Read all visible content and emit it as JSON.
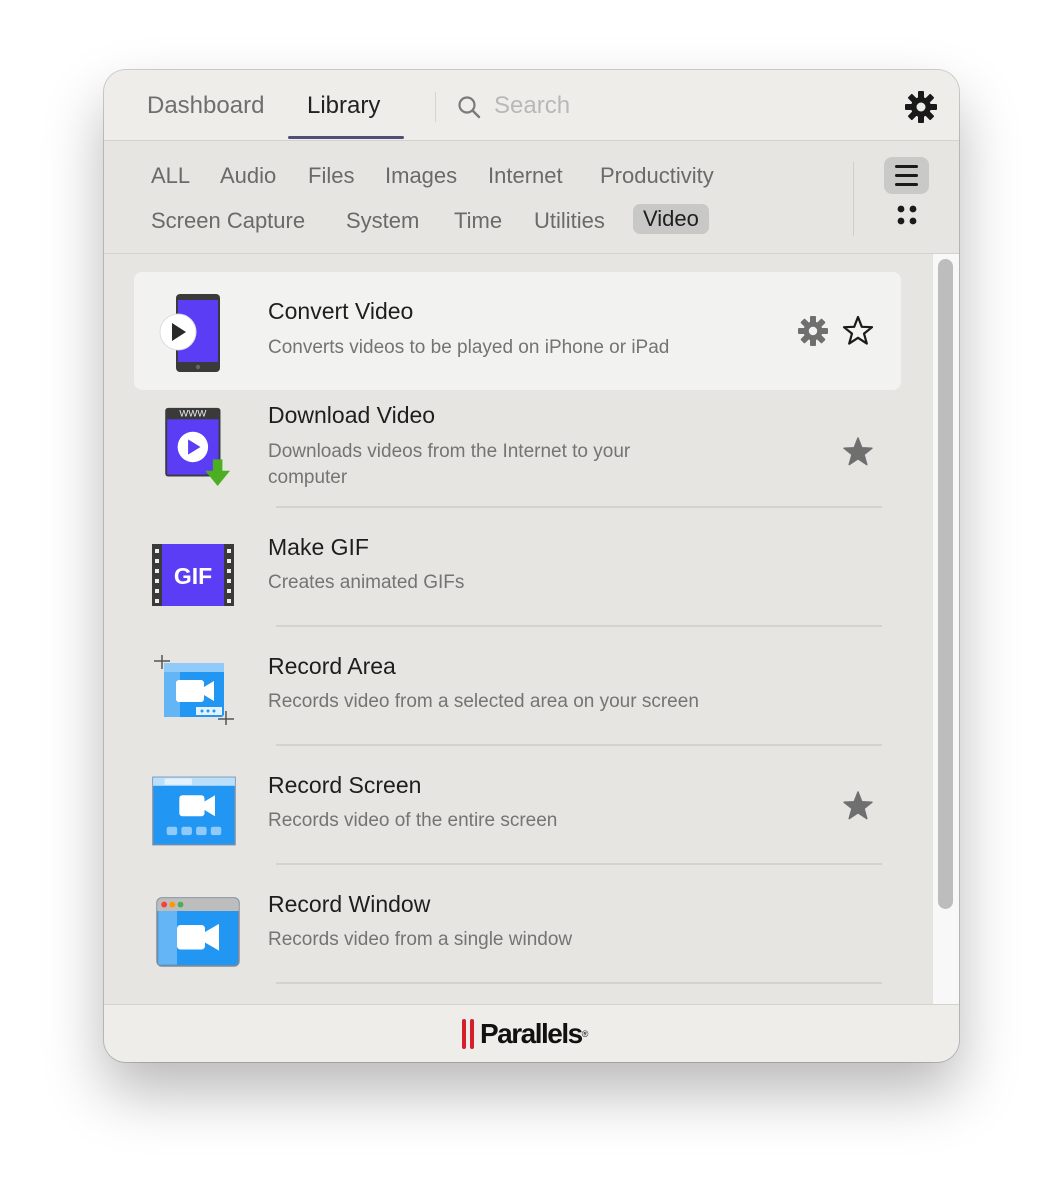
{
  "header": {
    "tabs": [
      {
        "label": "Dashboard",
        "active": false
      },
      {
        "label": "Library",
        "active": true
      }
    ],
    "search": {
      "placeholder": "Search",
      "value": ""
    },
    "settings_icon": "gear-icon"
  },
  "categories": {
    "items": [
      {
        "label": "ALL",
        "active": false
      },
      {
        "label": "Audio",
        "active": false
      },
      {
        "label": "Files",
        "active": false
      },
      {
        "label": "Images",
        "active": false
      },
      {
        "label": "Internet",
        "active": false
      },
      {
        "label": "Productivity",
        "active": false
      },
      {
        "label": "Screen Capture",
        "active": false
      },
      {
        "label": "System",
        "active": false
      },
      {
        "label": "Time",
        "active": false
      },
      {
        "label": "Utilities",
        "active": false
      },
      {
        "label": "Video",
        "active": true
      }
    ],
    "view_modes": [
      {
        "name": "list",
        "icon": "list-icon",
        "active": true
      },
      {
        "name": "grid",
        "icon": "grid-icon",
        "active": false
      }
    ]
  },
  "tools": [
    {
      "title": "Convert Video",
      "description": "Converts videos to be played on iPhone or iPad",
      "icon": "phone-play-icon",
      "favorite": false,
      "has_settings": true,
      "highlighted": true
    },
    {
      "title": "Download Video",
      "description": "Downloads videos from the Internet to your computer",
      "icon": "download-video-icon",
      "favorite": true,
      "has_settings": false,
      "highlighted": false
    },
    {
      "title": "Make GIF",
      "description": "Creates animated GIFs",
      "icon": "gif-film-icon",
      "icon_text": "GIF",
      "favorite": false,
      "has_settings": false,
      "highlighted": false
    },
    {
      "title": "Record Area",
      "description": "Records video from a selected area on your screen",
      "icon": "record-area-icon",
      "favorite": false,
      "has_settings": false,
      "highlighted": false
    },
    {
      "title": "Record Screen",
      "description": "Records video of the entire screen",
      "icon": "record-screen-icon",
      "favorite": true,
      "has_settings": false,
      "highlighted": false
    },
    {
      "title": "Record Window",
      "description": "Records video from a single window",
      "icon": "record-window-icon",
      "favorite": false,
      "has_settings": false,
      "highlighted": false
    }
  ],
  "footer": {
    "brand": "Parallels",
    "registered": "®"
  },
  "colors": {
    "accent_underline": "#4f5078",
    "brand_red": "#d51f2b",
    "icon_purple": "#5b3df5",
    "icon_blue": "#2196f3",
    "download_green": "#4caf22"
  }
}
